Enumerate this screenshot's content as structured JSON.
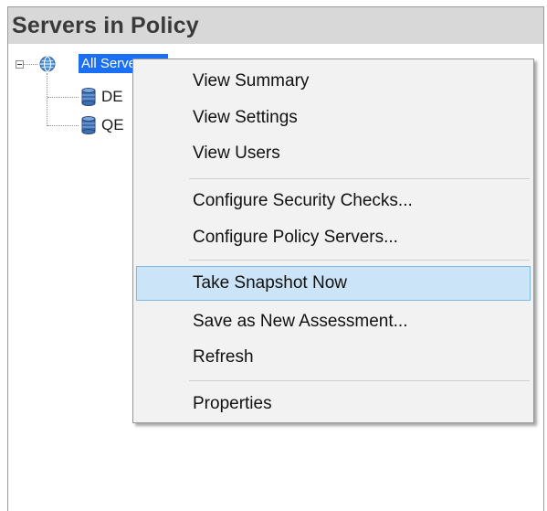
{
  "panel": {
    "title": "Servers in Policy"
  },
  "tree": {
    "root": {
      "label": "All Servers",
      "icon": "globe-icon",
      "expanded": true,
      "selected": true
    },
    "children": [
      {
        "label": "DE",
        "icon": "database-icon"
      },
      {
        "label": "QE",
        "icon": "database-icon"
      }
    ]
  },
  "context_menu": {
    "groups": [
      [
        {
          "label": "View Summary"
        },
        {
          "label": "View Settings"
        },
        {
          "label": "View Users"
        }
      ],
      [
        {
          "label": "Configure Security Checks..."
        },
        {
          "label": "Configure Policy Servers..."
        }
      ],
      [
        {
          "label": "Take Snapshot Now",
          "highlighted": true
        },
        {
          "label": "Save as New Assessment..."
        },
        {
          "label": "Refresh"
        }
      ],
      [
        {
          "label": "Properties"
        }
      ]
    ]
  },
  "colors": {
    "header_bg": "#d8d8d8",
    "selection_blue": "#1b6ff5",
    "menu_bg": "#f2f2f2",
    "menu_highlight": "#cce4f7",
    "menu_highlight_border": "#7fb8ea"
  }
}
